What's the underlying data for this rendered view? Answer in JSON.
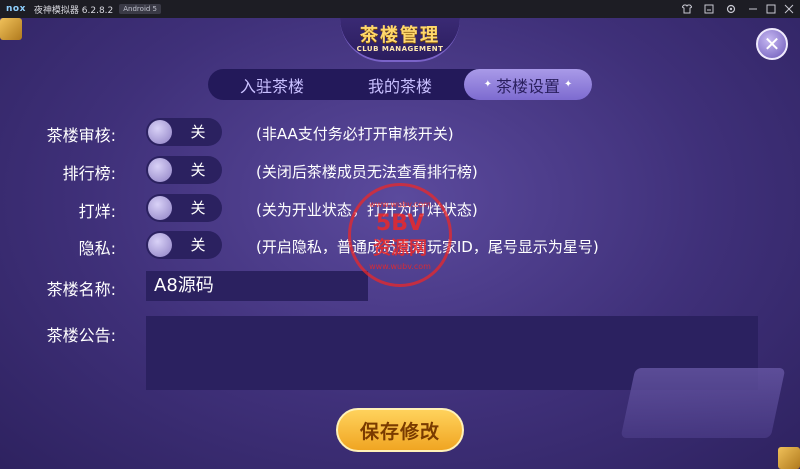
{
  "titlebar": {
    "logo": "nox",
    "title": "夜神模拟器 6.2.8.2",
    "badge": "Android 5",
    "icons": [
      "shirt-icon",
      "minimize-tray-icon",
      "settings-icon",
      "minimize-icon",
      "maximize-icon",
      "close-icon"
    ]
  },
  "header": {
    "title": "茶楼管理",
    "subtitle": "CLUB MANAGEMENT",
    "close_glyph": "✕"
  },
  "tabs": [
    {
      "label": "入驻茶楼",
      "active": false
    },
    {
      "label": "我的茶楼",
      "active": false
    },
    {
      "label": "茶楼设置",
      "active": true
    }
  ],
  "settings": [
    {
      "label": "茶楼审核:",
      "state": "关",
      "hint": "(非AA支付务必打开审核开关)"
    },
    {
      "label": "排行榜:",
      "state": "关",
      "hint": "(关闭后茶楼成员无法查看排行榜)"
    },
    {
      "label": "打烊:",
      "state": "关",
      "hint": "(关为开业状态，打开为打烊状态)"
    },
    {
      "label": "隐私:",
      "state": "关",
      "hint": "(开启隐私，普通成员查看玩家ID，尾号显示为星号)"
    }
  ],
  "name_field": {
    "label": "茶楼名称:",
    "value": "A8源码"
  },
  "notice_field": {
    "label": "茶楼公告:",
    "value": ""
  },
  "save_button": {
    "label": "保存修改"
  },
  "watermark": {
    "line1": "www.wubv.com",
    "line2": "5BV",
    "line3": "资源网",
    "line4": "www.wubv.com"
  },
  "colors": {
    "accent_gold": "#ffd25c",
    "panel_dark": "#2b2160",
    "tab_active": "#a99ae8"
  }
}
